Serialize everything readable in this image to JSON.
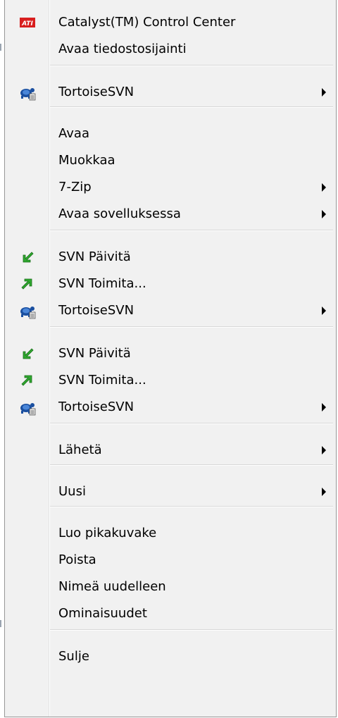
{
  "menu": {
    "sections": [
      {
        "items": [
          {
            "label": "Catalyst(TM) Control Center",
            "icon": "ati-icon",
            "submenu": false
          },
          {
            "label": "Avaa tiedostosijainti",
            "icon": "",
            "submenu": false
          }
        ]
      },
      {
        "items": [
          {
            "label": "TortoiseSVN",
            "icon": "tortoisesvn-icon",
            "submenu": true
          }
        ]
      },
      {
        "items": [
          {
            "label": "Avaa",
            "icon": "",
            "submenu": false
          },
          {
            "label": "Muokkaa",
            "icon": "",
            "submenu": false
          },
          {
            "label": "7-Zip",
            "icon": "",
            "submenu": true
          },
          {
            "label": "Avaa sovelluksessa",
            "icon": "",
            "submenu": true
          }
        ]
      },
      {
        "items": [
          {
            "label": "SVN Päivitä",
            "icon": "svn-update-icon",
            "submenu": false
          },
          {
            "label": "SVN Toimita...",
            "icon": "svn-commit-icon",
            "submenu": false
          },
          {
            "label": "TortoiseSVN",
            "icon": "tortoisesvn-icon",
            "submenu": true
          }
        ]
      },
      {
        "items": [
          {
            "label": "SVN Päivitä",
            "icon": "svn-update-icon",
            "submenu": false
          },
          {
            "label": "SVN Toimita...",
            "icon": "svn-commit-icon",
            "submenu": false
          },
          {
            "label": "TortoiseSVN",
            "icon": "tortoisesvn-icon",
            "submenu": true
          }
        ]
      },
      {
        "items": [
          {
            "label": "Lähetä",
            "icon": "",
            "submenu": true
          }
        ]
      },
      {
        "items": [
          {
            "label": "Uusi",
            "icon": "",
            "submenu": true
          }
        ]
      },
      {
        "items": [
          {
            "label": "Luo pikakuvake",
            "icon": "",
            "submenu": false
          },
          {
            "label": "Poista",
            "icon": "",
            "submenu": false
          },
          {
            "label": "Nimeä uudelleen",
            "icon": "",
            "submenu": false
          },
          {
            "label": "Ominaisuudet",
            "icon": "",
            "submenu": false
          }
        ]
      },
      {
        "items": [
          {
            "label": "Sulje",
            "icon": "",
            "submenu": false
          }
        ]
      }
    ],
    "colors": {
      "background": "#f1f1f1",
      "border": "#979797",
      "ati_red": "#d81e1e",
      "svn_green": "#2fa82f"
    }
  }
}
